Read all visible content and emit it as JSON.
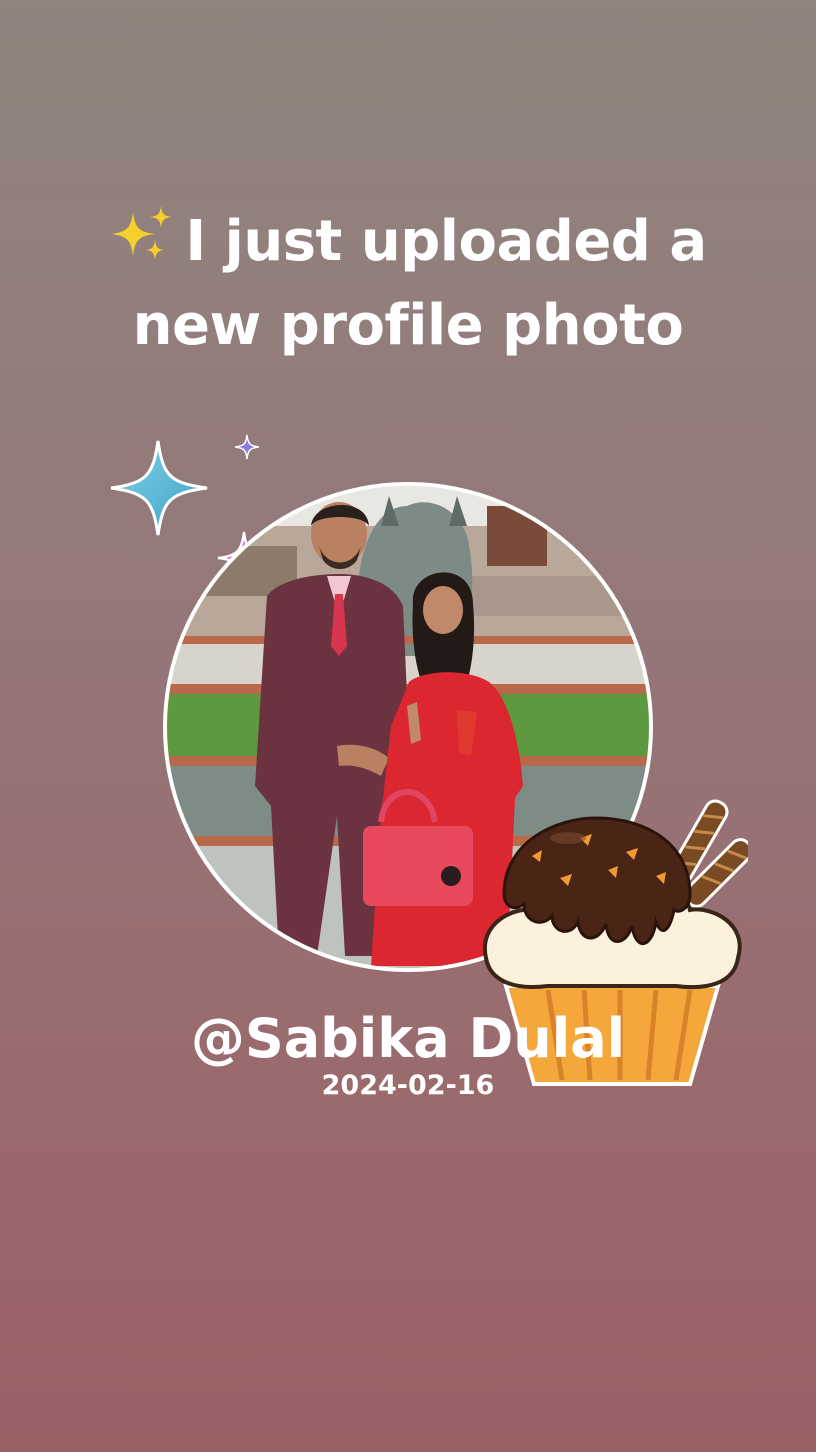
{
  "headline": {
    "line1": "I just uploaded a",
    "line2": "new profile photo",
    "leading_icon": "sparkles-emoji-icon"
  },
  "profile": {
    "photo": "couple-profile-photo",
    "username": "@Sabika Dulal",
    "date": "2024-02-16"
  },
  "decorations": {
    "sparkle_large": "teal-sparkle-icon",
    "sparkle_small": "violet-sparkle-icon",
    "sparkle_pink": "pink-sparkle-icon",
    "sticker": "chocolate-cupcake-icon"
  },
  "colors": {
    "background_top": "#8f857d",
    "background_bottom": "#9a6165",
    "text": "#ffffff",
    "photo_border": "#ffffff"
  }
}
